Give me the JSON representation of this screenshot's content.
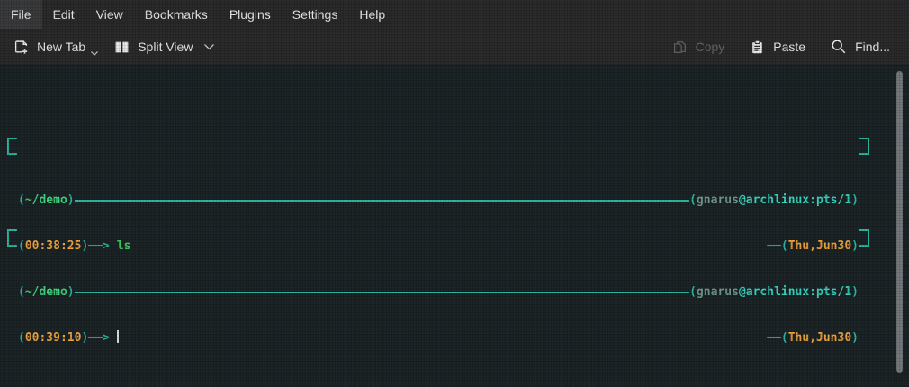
{
  "menu": {
    "items": [
      "File",
      "Edit",
      "View",
      "Bookmarks",
      "Plugins",
      "Settings",
      "Help"
    ]
  },
  "toolbar": {
    "new_tab_label": "New Tab",
    "split_view_label": "Split View",
    "copy_label": "Copy",
    "paste_label": "Paste",
    "find_label": "Find..."
  },
  "glyphs": {
    "open": "(",
    "close": ")",
    "at": "@",
    "arrow": "──>",
    "dash2": "──"
  },
  "terminal": {
    "blocks": [
      {
        "path": "~/demo",
        "user": "gnarus",
        "host": "archlinux:pts/1",
        "time": "00:38:25",
        "command": "ls",
        "date": "Thu,Jun30"
      },
      {
        "path": "~/demo",
        "user": "gnarus",
        "host": "archlinux:pts/1",
        "time": "00:39:10",
        "command": "",
        "date": "Thu,Jun30"
      }
    ]
  },
  "colors": {
    "chrome_bg": "#292929",
    "terminal_bg": "#1b2224",
    "teal": "#2eb6a0",
    "bright_teal": "#36d6c0",
    "dim_user": "#71988f",
    "green_path": "#3fd67e",
    "green_command": "#42cb5f",
    "orange": "#f1a63d",
    "cursor": "#dcdcdc",
    "scrollbar": "#75797c",
    "disabled_text": "#686868"
  }
}
